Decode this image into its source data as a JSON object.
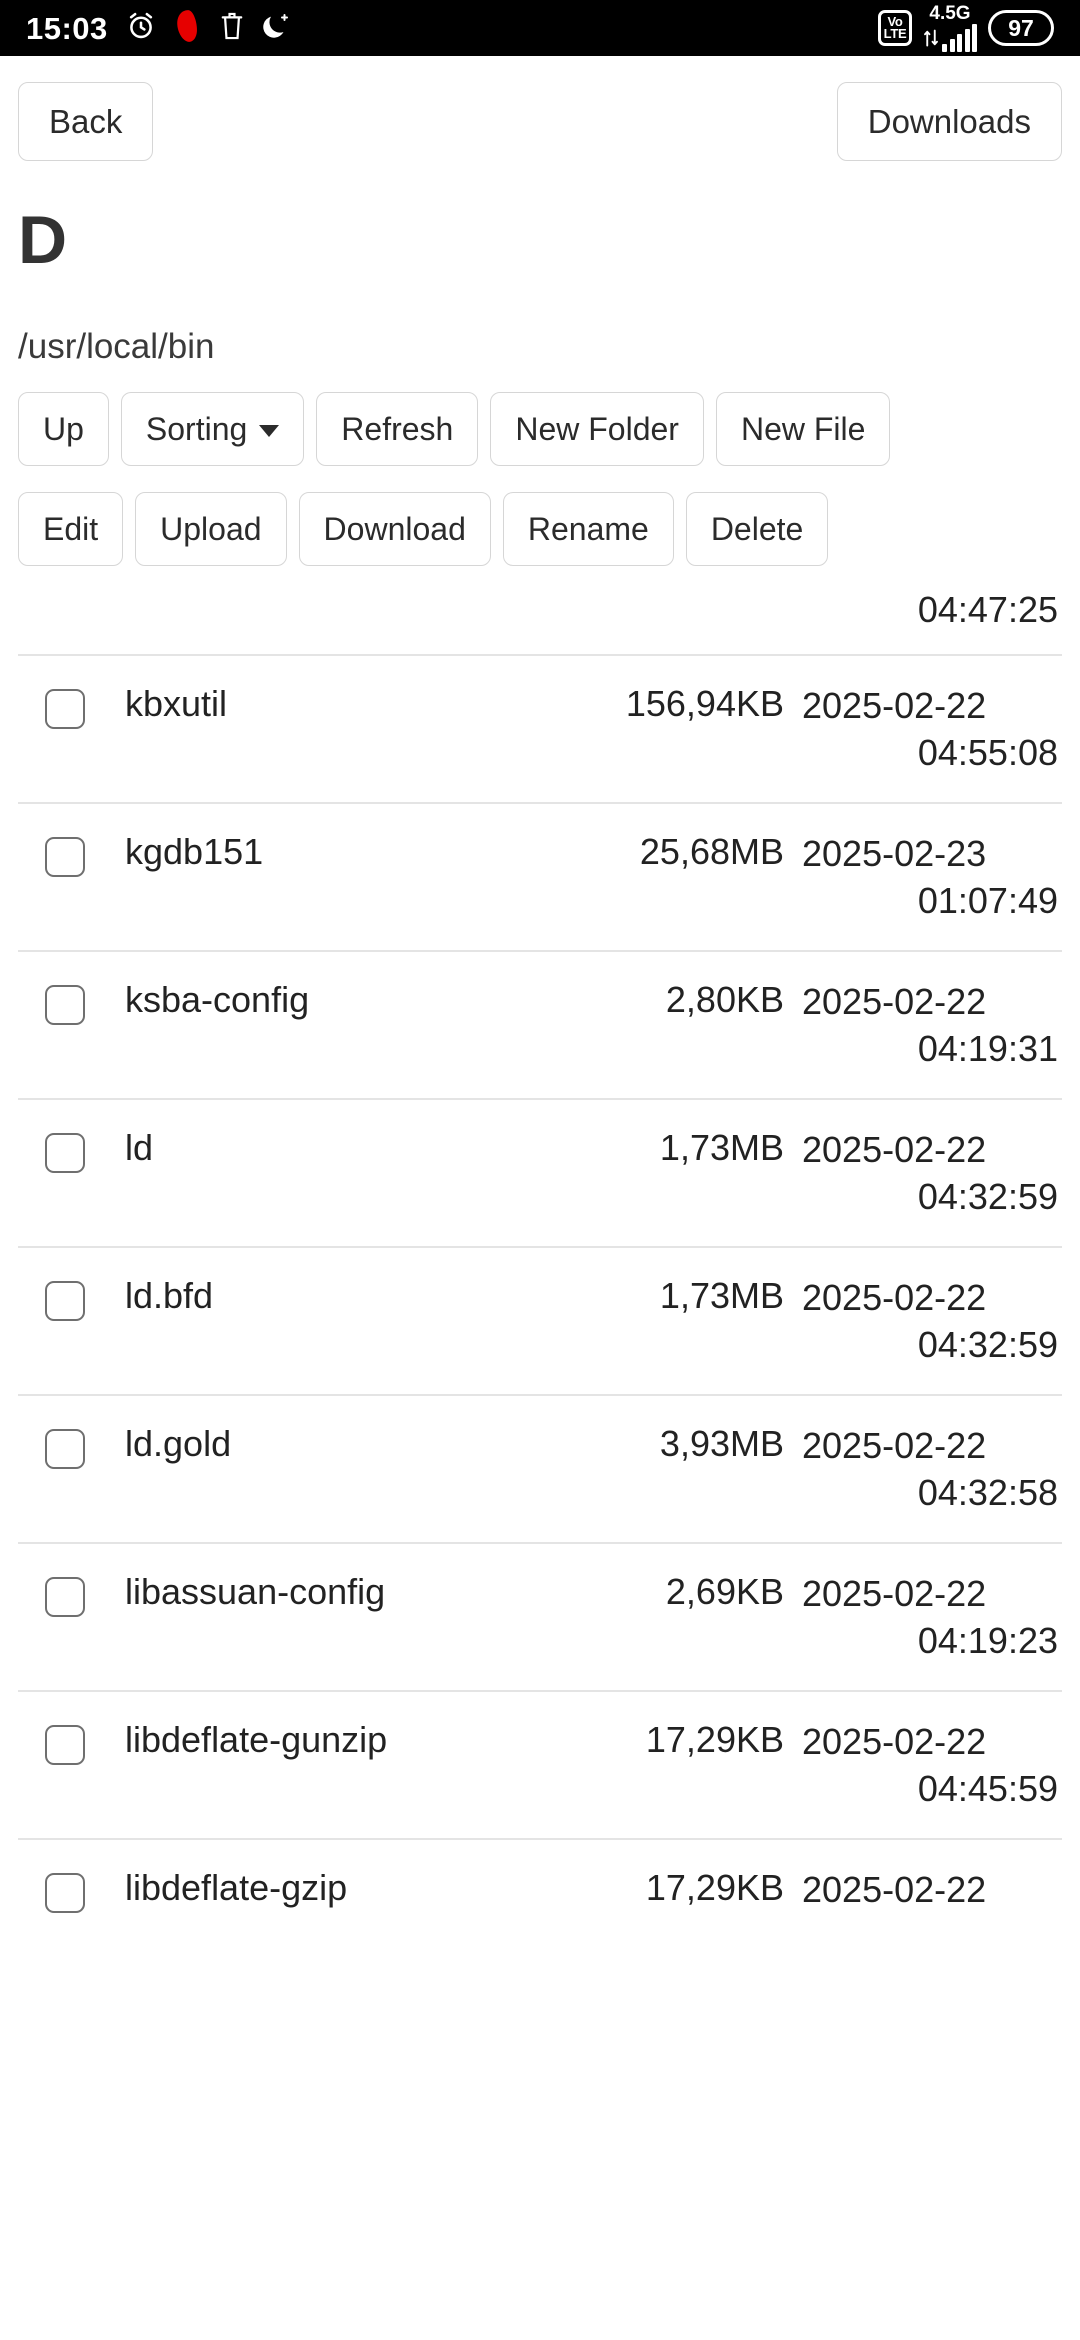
{
  "statusbar": {
    "time": "15:03",
    "icons_left": [
      "alarm-clock-icon",
      "vodafone-logo-icon",
      "trash-icon",
      "do-not-disturb-moon-icon"
    ],
    "volte_line1": "Vo",
    "volte_line2": "LTE",
    "network": "4.5G",
    "battery": "97"
  },
  "topbar": {
    "back_label": "Back",
    "downloads_label": "Downloads"
  },
  "header": {
    "title": "D",
    "path": "/usr/local/bin"
  },
  "toolbar": {
    "up_label": "Up",
    "sorting_label": "Sorting",
    "refresh_label": "Refresh",
    "new_folder_label": "New Folder",
    "new_file_label": "New File"
  },
  "actionbar": {
    "edit_label": "Edit",
    "upload_label": "Upload",
    "download_label": "Download",
    "rename_label": "Rename",
    "delete_label": "Delete"
  },
  "filelist": {
    "partial_top_row": {
      "time": "04:47:25"
    },
    "rows": [
      {
        "name": "kbxutil",
        "size": "156,94KB",
        "date": "2025-02-22",
        "time": "04:55:08"
      },
      {
        "name": "kgdb151",
        "size": "25,68MB",
        "date": "2025-02-23",
        "time": "01:07:49"
      },
      {
        "name": "ksba-config",
        "size": "2,80KB",
        "date": "2025-02-22",
        "time": "04:19:31"
      },
      {
        "name": "ld",
        "size": "1,73MB",
        "date": "2025-02-22",
        "time": "04:32:59"
      },
      {
        "name": "ld.bfd",
        "size": "1,73MB",
        "date": "2025-02-22",
        "time": "04:32:59"
      },
      {
        "name": "ld.gold",
        "size": "3,93MB",
        "date": "2025-02-22",
        "time": "04:32:58"
      },
      {
        "name": "libassuan-config",
        "size": "2,69KB",
        "date": "2025-02-22",
        "time": "04:19:23"
      },
      {
        "name": "libdeflate-gunzip",
        "size": "17,29KB",
        "date": "2025-02-22",
        "time": "04:45:59"
      },
      {
        "name": "libdeflate-gzip",
        "size": "17,29KB",
        "date": "2025-02-22",
        "time": ""
      }
    ]
  },
  "colors": {
    "accent_red": "#e60000",
    "border": "#d6d6d6",
    "text": "#222222",
    "statusbar_bg": "#000000"
  }
}
